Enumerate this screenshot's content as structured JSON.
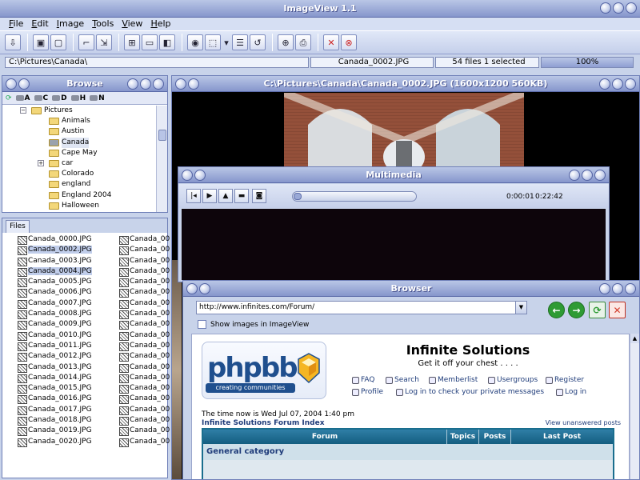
{
  "app": {
    "title": "ImageView 1.1"
  },
  "menu": [
    "File",
    "Edit",
    "Image",
    "Tools",
    "View",
    "Help"
  ],
  "statusbar": {
    "path": "C:\\Pictures\\Canada\\",
    "filename": "Canada_0002.JPG",
    "counts": "54 files  1 selected",
    "zoom": "100%"
  },
  "browse": {
    "title": "Browse",
    "drives": [
      "A",
      "C",
      "D",
      "H",
      "N"
    ],
    "tree": [
      {
        "label": "Pictures",
        "depth": 0,
        "expand": "−"
      },
      {
        "label": "Animals",
        "depth": 1
      },
      {
        "label": "Austin",
        "depth": 1
      },
      {
        "label": "Canada",
        "depth": 1,
        "selected": true
      },
      {
        "label": "Cape May",
        "depth": 1
      },
      {
        "label": "car",
        "depth": 1,
        "expand": "+"
      },
      {
        "label": "Colorado",
        "depth": 1
      },
      {
        "label": "england",
        "depth": 1
      },
      {
        "label": "England 2004",
        "depth": 1
      },
      {
        "label": "Halloween",
        "depth": 1
      }
    ]
  },
  "files": {
    "tab": "Files",
    "col1": [
      "Canada_0000.JPG",
      "Canada_0002.JPG",
      "Canada_0003.JPG",
      "Canada_0004.JPG",
      "Canada_0005.JPG",
      "Canada_0006.JPG",
      "Canada_0007.JPG",
      "Canada_0008.JPG",
      "Canada_0009.JPG",
      "Canada_0010.JPG",
      "Canada_0011.JPG",
      "Canada_0012.JPG",
      "Canada_0013.JPG",
      "Canada_0014.JPG",
      "Canada_0015.JPG",
      "Canada_0016.JPG",
      "Canada_0017.JPG",
      "Canada_0018.JPG",
      "Canada_0019.JPG",
      "Canada_0020.JPG"
    ],
    "col1_selected": [
      1,
      3
    ],
    "col2_label": "Canada_00",
    "col2_count": 20
  },
  "viewer": {
    "title": "C:\\Pictures\\Canada\\Canada_0002.JPG  (1600x1200 560KB)"
  },
  "multimedia": {
    "title": "Multimedia",
    "elapsed": "0:00:01",
    "duration": "0:22:42",
    "progress": 0.0007
  },
  "browser": {
    "title": "Browser",
    "url": "http://www.infinites.com/Forum/",
    "show_images_label": "Show images in ImageView",
    "page": {
      "logo_word": "phpbb",
      "logo_strip": "creating communities",
      "site_name": "Infinite Solutions",
      "tagline": "Get it off your chest . . . .",
      "nav": {
        "faq": "FAQ",
        "search": "Search",
        "memberlist": "Memberlist",
        "usergroups": "Usergroups",
        "register": "Register",
        "profile": "Profile",
        "private_msgs": "Log in to check your private messages",
        "login": "Log in"
      },
      "time_now": "The time now is Wed Jul 07, 2004 1:40 pm",
      "forum_index": "Infinite Solutions Forum Index",
      "view_unanswered": "View unanswered posts",
      "table_headers": [
        "Forum",
        "Topics",
        "Posts",
        "Last Post"
      ],
      "category": "General category"
    }
  },
  "colors": {
    "title_bar": "#8696cc",
    "selection": "#c0cdea",
    "go_green": "#2e9b34",
    "stop_red": "#d23a2a",
    "forum_header": "#145e80"
  }
}
